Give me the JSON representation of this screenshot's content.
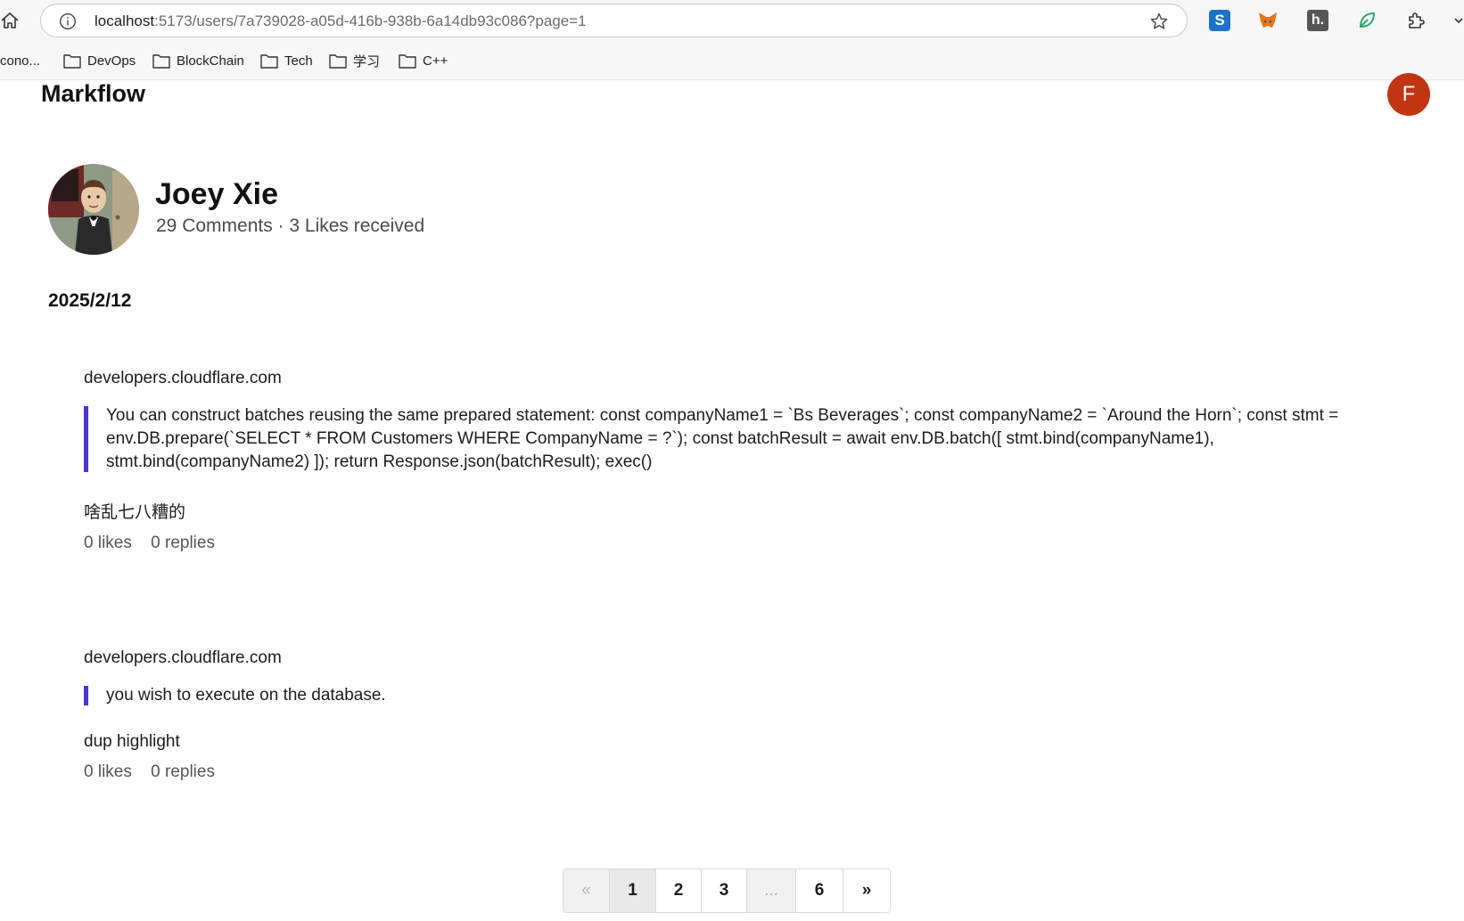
{
  "browser": {
    "url_host": "localhost",
    "url_path": ":5173/users/7a739028-a05d-416b-938b-6a14db93c086?page=1",
    "extensions": {
      "s_label": "S",
      "h_label": "h."
    },
    "bookmarks": [
      {
        "label": "cono..."
      },
      {
        "label": "DevOps"
      },
      {
        "label": "BlockChain"
      },
      {
        "label": "Tech"
      },
      {
        "label": "学习"
      },
      {
        "label": "C++"
      }
    ]
  },
  "header": {
    "brand": "Markflow",
    "user_initial": "F",
    "user_avatar_color": "#c23512"
  },
  "profile": {
    "name": "Joey Xie",
    "stats": "29 Comments · 3 Likes received"
  },
  "feed": {
    "date": "2025/2/12",
    "comments": [
      {
        "source": "developers.cloudflare.com",
        "quote_lines": [
          "You can construct batches reusing the same prepared statement: const companyName1 = `Bs Beverages`; const companyName2 = `Around the Horn`; const stmt =",
          "env.DB.prepare(`SELECT * FROM Customers WHERE CompanyName = ?`); const batchResult = await env.DB.batch([ stmt.bind(companyName1),",
          "stmt.bind(companyName2) ]); return Response.json(batchResult); exec()"
        ],
        "note": "啥乱七八糟的",
        "likes": "0 likes",
        "replies": "0 replies"
      },
      {
        "source": "developers.cloudflare.com",
        "quote_lines": [
          "you wish to execute on the database."
        ],
        "note": "dup highlight",
        "likes": "0 likes",
        "replies": "0 replies"
      }
    ],
    "quote_border_color": "#4338ca"
  },
  "pagination": {
    "prev": "«",
    "pages": [
      "1",
      "2",
      "3"
    ],
    "ellipsis": "...",
    "last": "6",
    "next": "»",
    "current": "1"
  }
}
